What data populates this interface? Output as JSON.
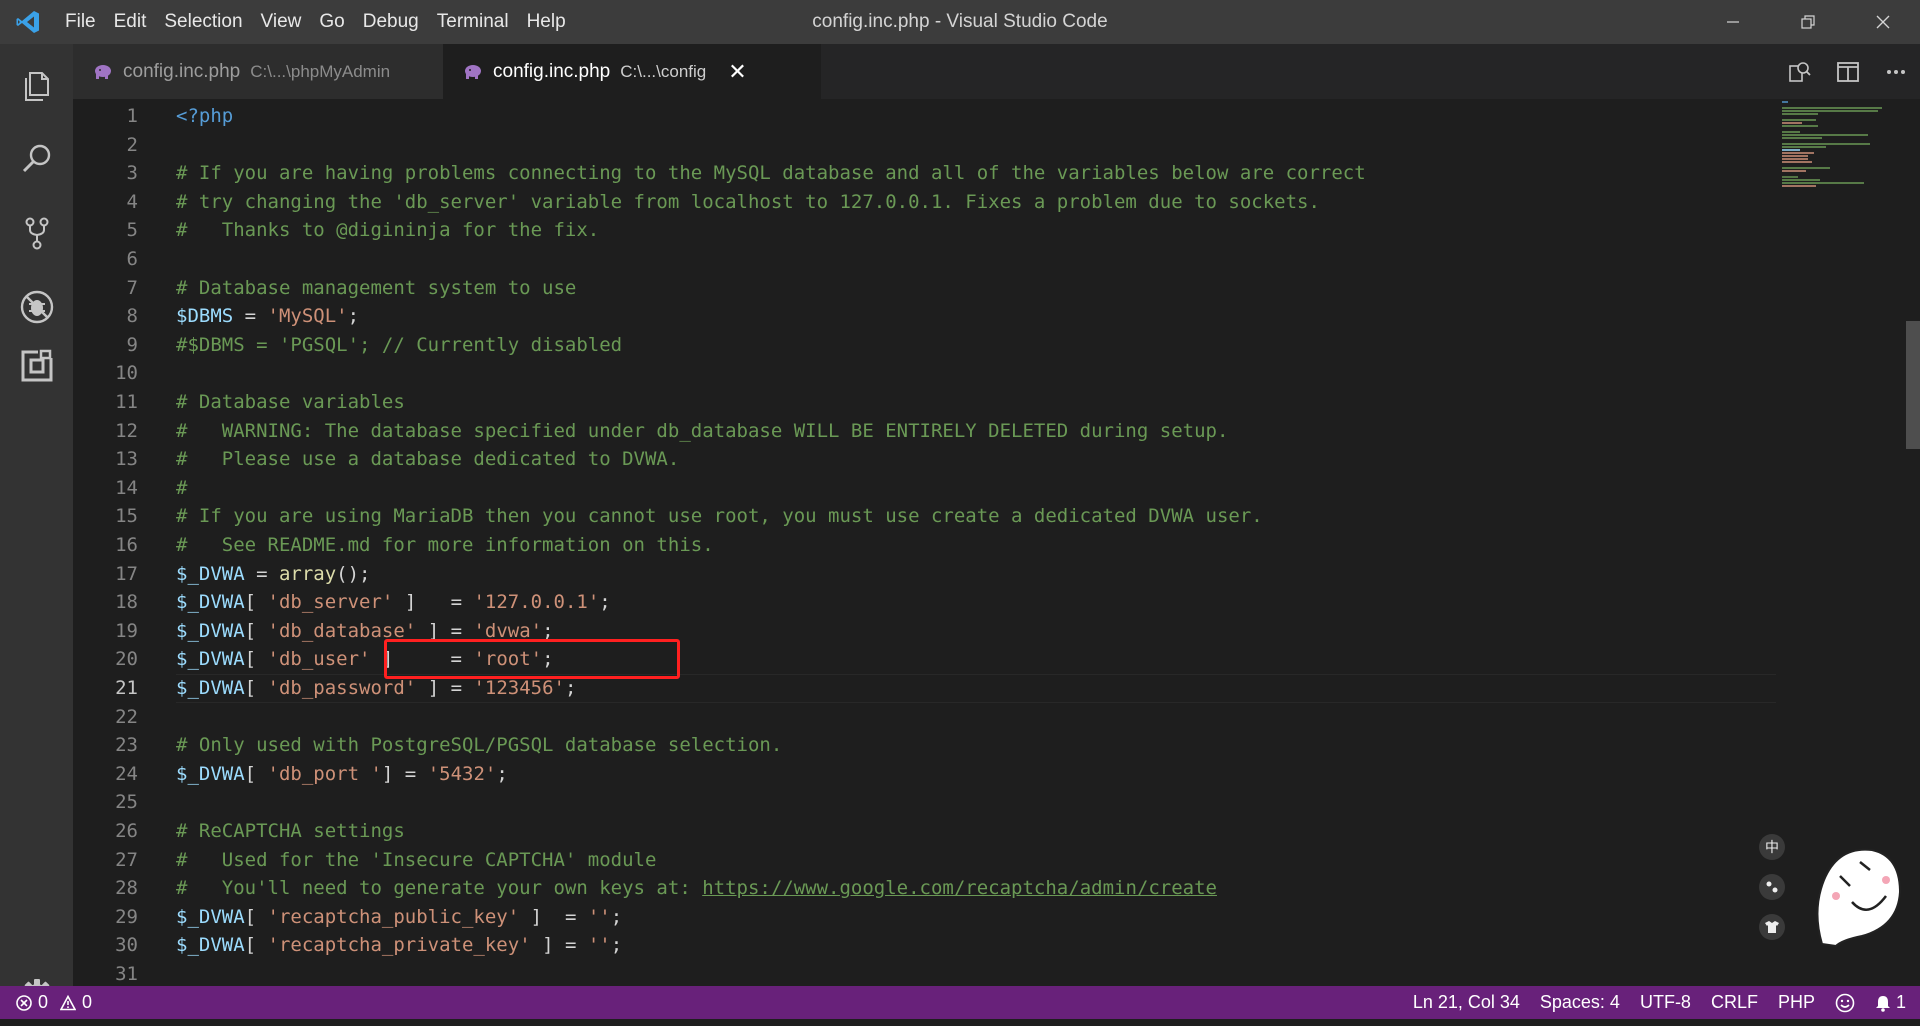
{
  "window": {
    "title": "config.inc.php - Visual Studio Code",
    "menu": [
      "File",
      "Edit",
      "Selection",
      "View",
      "Go",
      "Debug",
      "Terminal",
      "Help"
    ]
  },
  "tabs": [
    {
      "name": "config.inc.php",
      "path": "C:\\...\\phpMyAdmin",
      "active": false
    },
    {
      "name": "config.inc.php",
      "path": "C:\\...\\config",
      "active": true
    }
  ],
  "editor": {
    "current_line": 21,
    "lines": [
      {
        "n": "1",
        "segs": [
          [
            "t",
            "<?php"
          ]
        ]
      },
      {
        "n": "2",
        "segs": []
      },
      {
        "n": "3",
        "segs": [
          [
            "c",
            "# If you are having problems connecting to the MySQL database and all of the variables below are correct"
          ]
        ]
      },
      {
        "n": "4",
        "segs": [
          [
            "c",
            "# try changing the 'db_server' variable from localhost to 127.0.0.1. Fixes a problem due to sockets."
          ]
        ]
      },
      {
        "n": "5",
        "segs": [
          [
            "c",
            "#   Thanks to @digininja for the fix."
          ]
        ]
      },
      {
        "n": "6",
        "segs": []
      },
      {
        "n": "7",
        "segs": [
          [
            "c",
            "# Database management system to use"
          ]
        ]
      },
      {
        "n": "8",
        "segs": [
          [
            "v",
            "$DBMS"
          ],
          [
            "p",
            " = "
          ],
          [
            "s",
            "'MySQL'"
          ],
          [
            "p",
            ";"
          ]
        ]
      },
      {
        "n": "9",
        "segs": [
          [
            "c",
            "#$DBMS = 'PGSQL'; // Currently disabled"
          ]
        ]
      },
      {
        "n": "10",
        "segs": []
      },
      {
        "n": "11",
        "segs": [
          [
            "c",
            "# Database variables"
          ]
        ]
      },
      {
        "n": "12",
        "segs": [
          [
            "c",
            "#   WARNING: The database specified under db_database WILL BE ENTIRELY DELETED during setup."
          ]
        ]
      },
      {
        "n": "13",
        "segs": [
          [
            "c",
            "#   Please use a database dedicated to DVWA."
          ]
        ]
      },
      {
        "n": "14",
        "segs": [
          [
            "c",
            "#"
          ]
        ]
      },
      {
        "n": "15",
        "segs": [
          [
            "c",
            "# If you are using MariaDB then you cannot use root, you must use create a dedicated DVWA user."
          ]
        ]
      },
      {
        "n": "16",
        "segs": [
          [
            "c",
            "#   See README.md for more information on this."
          ]
        ]
      },
      {
        "n": "17",
        "segs": [
          [
            "v",
            "$_DVWA"
          ],
          [
            "p",
            " = "
          ],
          [
            "f",
            "array"
          ],
          [
            "p",
            "();"
          ]
        ]
      },
      {
        "n": "18",
        "segs": [
          [
            "v",
            "$_DVWA"
          ],
          [
            "p",
            "[ "
          ],
          [
            "s",
            "'db_server'"
          ],
          [
            "p",
            " ]   = "
          ],
          [
            "s",
            "'127.0.0.1'"
          ],
          [
            "p",
            ";"
          ]
        ]
      },
      {
        "n": "19",
        "segs": [
          [
            "v",
            "$_DVWA"
          ],
          [
            "p",
            "[ "
          ],
          [
            "s",
            "'db_database'"
          ],
          [
            "p",
            " ] = "
          ],
          [
            "s",
            "'dvwa'"
          ],
          [
            "p",
            ";"
          ]
        ]
      },
      {
        "n": "20",
        "segs": [
          [
            "v",
            "$_DVWA"
          ],
          [
            "p",
            "[ "
          ],
          [
            "s",
            "'db_user'"
          ],
          [
            "p",
            " ]     = "
          ],
          [
            "s",
            "'root'"
          ],
          [
            "p",
            ";"
          ]
        ]
      },
      {
        "n": "21",
        "segs": [
          [
            "v",
            "$_DVWA"
          ],
          [
            "p",
            "[ "
          ],
          [
            "s",
            "'db_password'"
          ],
          [
            "p",
            " ] = "
          ],
          [
            "s",
            "'123456'"
          ],
          [
            "p",
            ";"
          ]
        ]
      },
      {
        "n": "22",
        "segs": []
      },
      {
        "n": "23",
        "segs": [
          [
            "c",
            "# Only used with PostgreSQL/PGSQL database selection."
          ]
        ]
      },
      {
        "n": "24",
        "segs": [
          [
            "v",
            "$_DVWA"
          ],
          [
            "p",
            "[ "
          ],
          [
            "s",
            "'db_port '"
          ],
          [
            "p",
            "] = "
          ],
          [
            "s",
            "'5432'"
          ],
          [
            "p",
            ";"
          ]
        ]
      },
      {
        "n": "25",
        "segs": []
      },
      {
        "n": "26",
        "segs": [
          [
            "c",
            "# ReCAPTCHA settings"
          ]
        ]
      },
      {
        "n": "27",
        "segs": [
          [
            "c",
            "#   Used for the 'Insecure CAPTCHA' module"
          ]
        ]
      },
      {
        "n": "28",
        "segs": [
          [
            "c",
            "#   You'll need to generate your own keys at: "
          ],
          [
            "u",
            "https://www.google.com/recaptcha/admin/create"
          ]
        ]
      },
      {
        "n": "29",
        "segs": [
          [
            "v",
            "$_DVWA"
          ],
          [
            "p",
            "[ "
          ],
          [
            "s",
            "'recaptcha_public_key'"
          ],
          [
            "p",
            " ]  = "
          ],
          [
            "s",
            "''"
          ],
          [
            "p",
            ";"
          ]
        ]
      },
      {
        "n": "30",
        "segs": [
          [
            "v",
            "$_DVWA"
          ],
          [
            "p",
            "[ "
          ],
          [
            "s",
            "'recaptcha_private_key'"
          ],
          [
            "p",
            " ] = "
          ],
          [
            "s",
            "''"
          ],
          [
            "p",
            ";"
          ]
        ]
      },
      {
        "n": "31",
        "segs": []
      }
    ]
  },
  "statusbar": {
    "errors": "0",
    "warnings": "0",
    "position": "Ln 21, Col 34",
    "spaces": "Spaces: 4",
    "encoding": "UTF-8",
    "eol": "CRLF",
    "language": "PHP",
    "notifications": "1"
  },
  "ime": {
    "label": "中"
  },
  "colors": {
    "statusbar": "#68217a",
    "highlight": "#ff2020",
    "comment": "#6a9955",
    "string": "#ce9178",
    "variable": "#9cdcfe",
    "keyword": "#569cd6"
  }
}
